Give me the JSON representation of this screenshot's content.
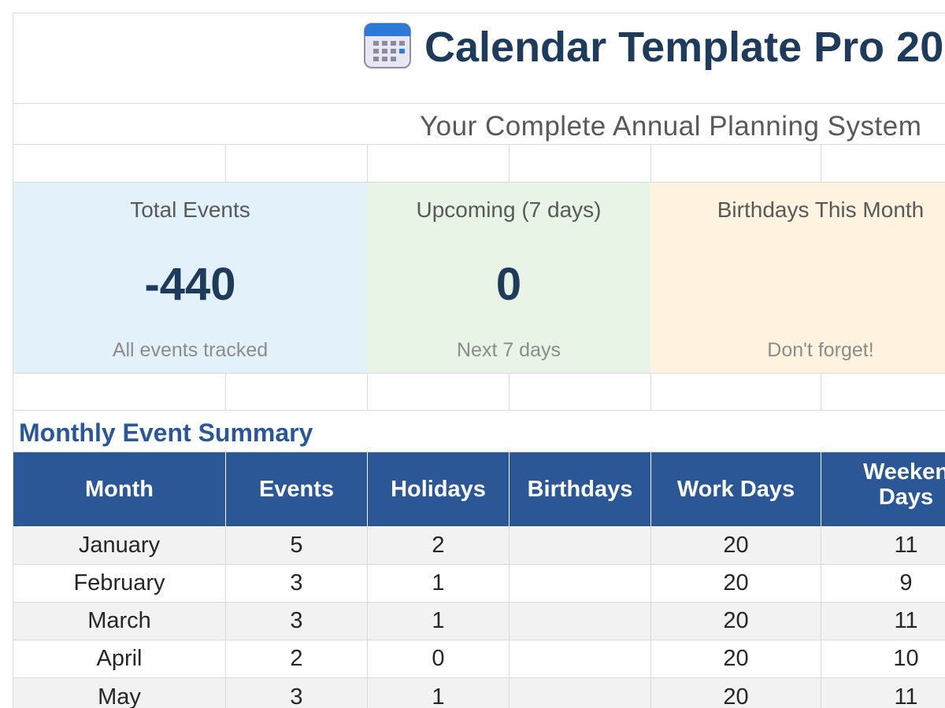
{
  "header": {
    "title": "Calendar Template Pro 20",
    "subtitle": "Your Complete Annual Planning System"
  },
  "icons": {
    "title_icon": "calendar-icon"
  },
  "colors": {
    "title": "#1f3b5c",
    "table_header": "#2b5797",
    "section_title": "#2b5797",
    "card_blue": "#e3f1fb",
    "card_green": "#e7f4e6",
    "card_orange": "#fff2df"
  },
  "kpis": [
    {
      "label": "Total Events",
      "value": "-440",
      "sub": "All events tracked"
    },
    {
      "label": "Upcoming (7 days)",
      "value": "0",
      "sub": "Next 7 days"
    },
    {
      "label": "Birthdays This Month",
      "value": "",
      "sub": "Don't forget!"
    }
  ],
  "summary": {
    "title": "Monthly Event Summary",
    "columns": [
      "Month",
      "Events",
      "Holidays",
      "Birthdays",
      "Work Days",
      "Weeken",
      "Days"
    ],
    "rows": [
      {
        "month": "January",
        "events": "5",
        "holidays": "2",
        "birthdays": "",
        "work_days": "20",
        "weekend_days": "11"
      },
      {
        "month": "February",
        "events": "3",
        "holidays": "1",
        "birthdays": "",
        "work_days": "20",
        "weekend_days": "9"
      },
      {
        "month": "March",
        "events": "3",
        "holidays": "1",
        "birthdays": "",
        "work_days": "20",
        "weekend_days": "11"
      },
      {
        "month": "April",
        "events": "2",
        "holidays": "0",
        "birthdays": "",
        "work_days": "20",
        "weekend_days": "10"
      },
      {
        "month": "May",
        "events": "3",
        "holidays": "1",
        "birthdays": "",
        "work_days": "20",
        "weekend_days": "11"
      }
    ]
  }
}
